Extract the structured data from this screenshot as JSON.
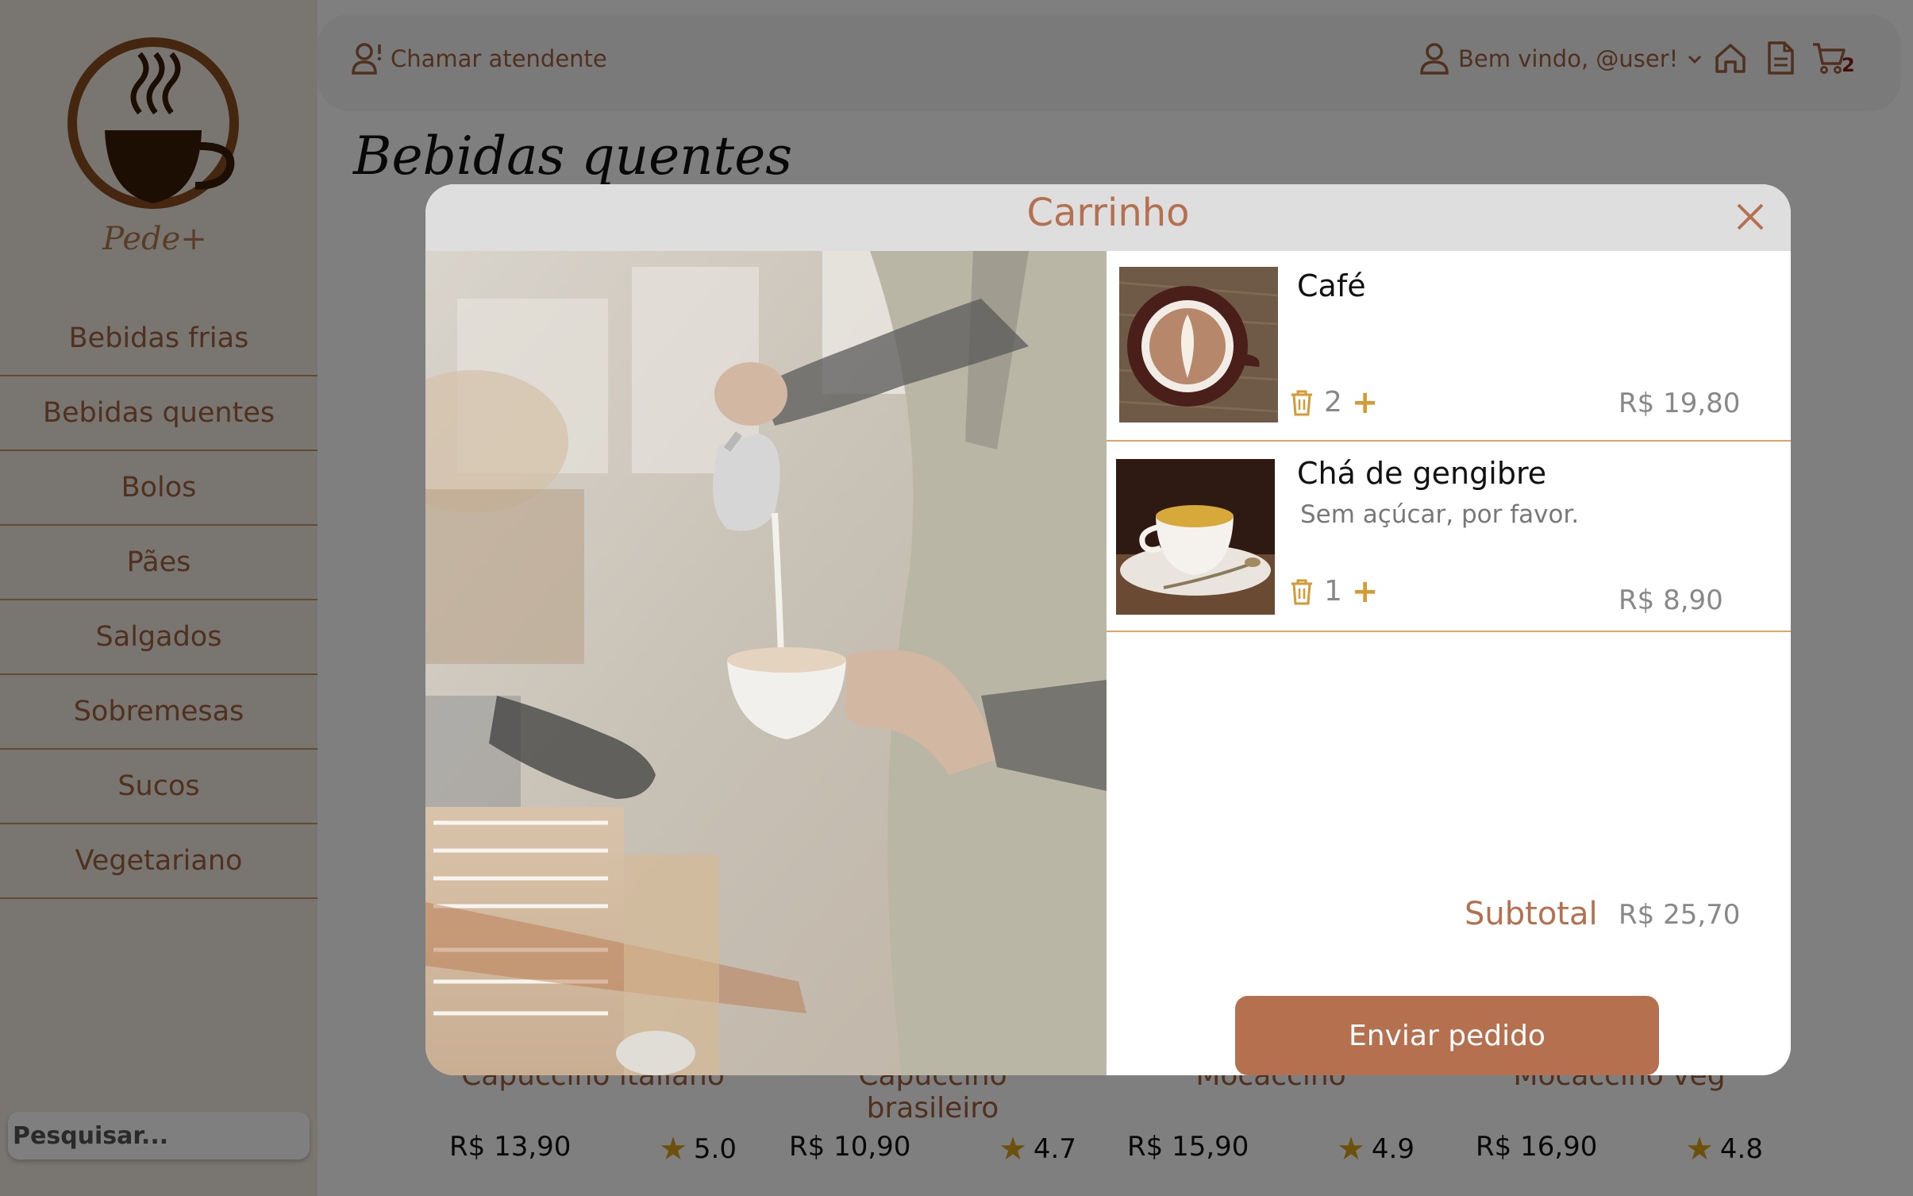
{
  "sidebar": {
    "brand": "Pede+",
    "items": [
      {
        "label": "Bebidas frias"
      },
      {
        "label": "Bebidas quentes"
      },
      {
        "label": "Bolos"
      },
      {
        "label": "Pães"
      },
      {
        "label": "Salgados"
      },
      {
        "label": "Sobremesas"
      },
      {
        "label": "Sucos"
      },
      {
        "label": "Vegetariano"
      }
    ],
    "search_placeholder": "Pesquisar..."
  },
  "topbar": {
    "call_label": "Chamar atendente",
    "welcome_label": "Bem vindo, @user!",
    "cart_count": "2",
    "icons": [
      "user-alert-icon",
      "user-icon",
      "chevron-down-icon",
      "home-icon",
      "document-icon",
      "cart-icon"
    ]
  },
  "page": {
    "title": "Bebidas quentes"
  },
  "products": [
    {
      "name": "Capuccino italiano",
      "price": "R$ 13,90",
      "rating": "5.0"
    },
    {
      "name": "Capuccino brasileiro",
      "price": "R$ 10,90",
      "rating": "4.7"
    },
    {
      "name": "Mocaccino",
      "price": "R$ 15,90",
      "rating": "4.9"
    },
    {
      "name": "Mocaccino veg",
      "price": "R$ 16,90",
      "rating": "4.8"
    }
  ],
  "cart": {
    "title": "Carrinho",
    "items": [
      {
        "name": "Café",
        "note": "",
        "qty": "2",
        "price": "R$ 19,80"
      },
      {
        "name": "Chá de gengibre",
        "note": "Sem açúcar, por favor.",
        "qty": "1",
        "price": "R$ 8,90"
      }
    ],
    "subtotal_label": "Subtotal",
    "subtotal_value": "R$ 25,70",
    "send_label": "Enviar pedido",
    "plus_symbol": "+"
  },
  "colors": {
    "accent": "#b5714f",
    "nav_text": "#a0603d",
    "divider": "#d9a766",
    "sidebar_bg": "#f2ece2"
  }
}
